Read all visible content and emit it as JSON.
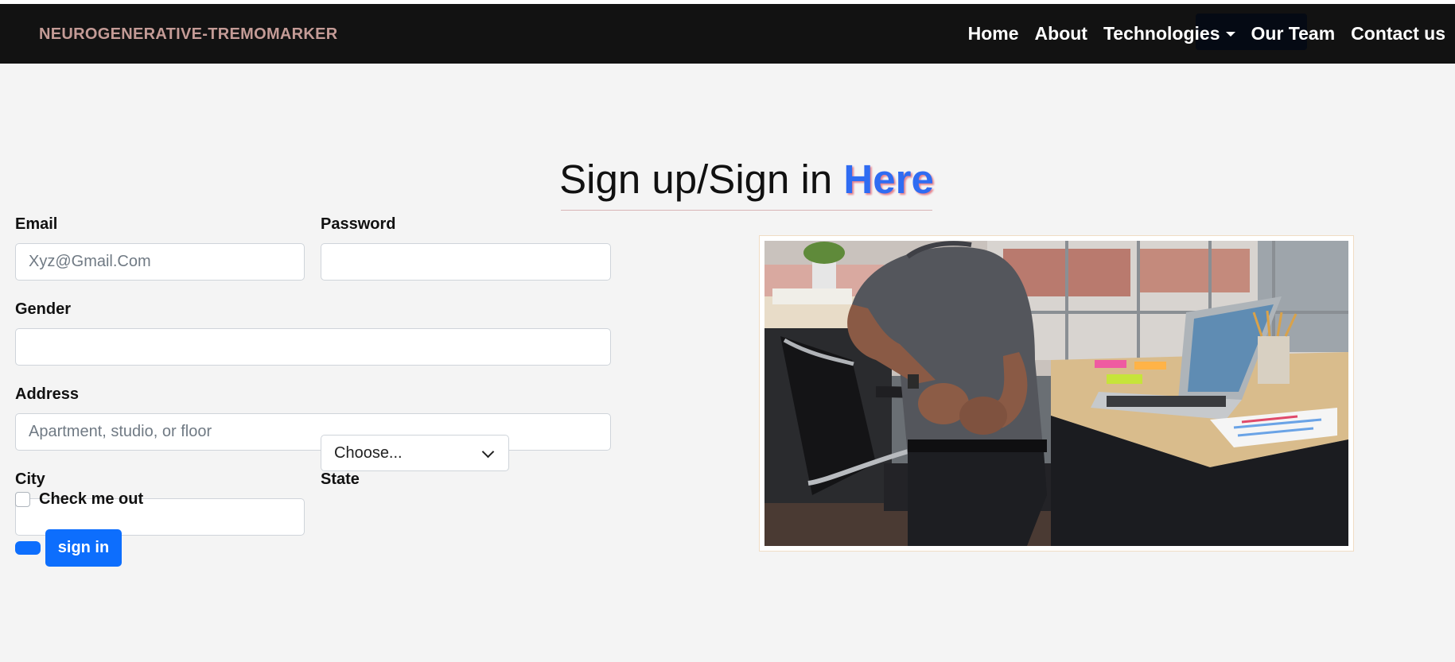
{
  "navbar": {
    "brand": "NEUROGENERATIVE-TREMOMARKER",
    "links": [
      "Home",
      "About",
      "Technologies",
      "Our Team",
      "Contact us"
    ]
  },
  "heading": {
    "prefix": "Sign up/Sign in",
    "accent": "Here"
  },
  "form": {
    "email": {
      "label": "Email",
      "placeholder": "Xyz@Gmail.Com",
      "value": ""
    },
    "password": {
      "label": "Password",
      "value": ""
    },
    "gender": {
      "label": "Gender",
      "value": ""
    },
    "address": {
      "label": "Address",
      "placeholder": "Apartment, studio, or floor",
      "value": ""
    },
    "city": {
      "label": "City",
      "value": ""
    },
    "state": {
      "label": "State",
      "selected": "Choose..."
    },
    "checkbox_label": "Check me out",
    "submit_label": "sign in"
  },
  "image": {
    "subject": "man at office desk holding lower back in pain",
    "alt_icon": "back-pain-photo"
  },
  "colors": {
    "navbar_bg": "#121212",
    "brand": "#c49b96",
    "accent": "#2f6cf2",
    "button": "#0d6efd",
    "page_bg": "#f4f4f4"
  }
}
